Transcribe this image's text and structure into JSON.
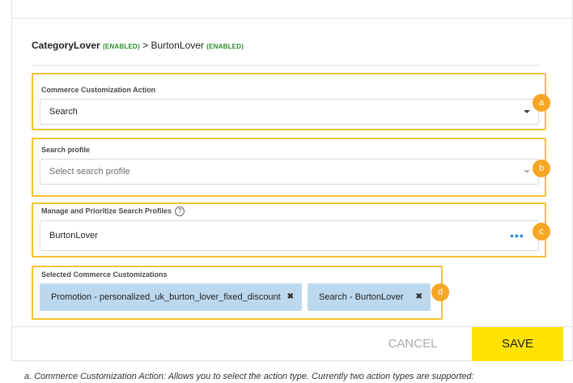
{
  "breadcrumb": {
    "first_name": "CategoryLover",
    "first_status": "(ENABLED)",
    "separator": ">",
    "second_name": "BurtonLover",
    "second_status": "(ENABLED)"
  },
  "action_section": {
    "label": "Commerce Customization Action",
    "value": "Search",
    "badge": "a"
  },
  "search_profile_section": {
    "label": "Search profile",
    "placeholder": "Select search profile",
    "badge": "b"
  },
  "manage_section": {
    "label": "Manage and Prioritize Search Profiles",
    "help": "?",
    "value": "BurtonLover",
    "more": "•••",
    "badge": "c"
  },
  "selected_section": {
    "label": "Selected Commerce Customizations",
    "chips": [
      {
        "label": "Promotion - personalized_uk_burton_lover_fixed_discount",
        "remove": "✖"
      },
      {
        "label": "Search - BurtonLover",
        "remove": "✖"
      }
    ],
    "badge": "d"
  },
  "footer": {
    "cancel_label": "CANCEL",
    "save_label": "SAVE"
  },
  "footnote": "a. Commerce Customization Action: Allows you to select the action type. Currently two action types are supported:",
  "colors": {
    "highlight": "#f5c12f",
    "badge": "#f5a623",
    "chip": "#bcd8ee",
    "save": "#ffe200",
    "enabled": "#2e8b2e",
    "more_dots": "#3a8fd9"
  }
}
